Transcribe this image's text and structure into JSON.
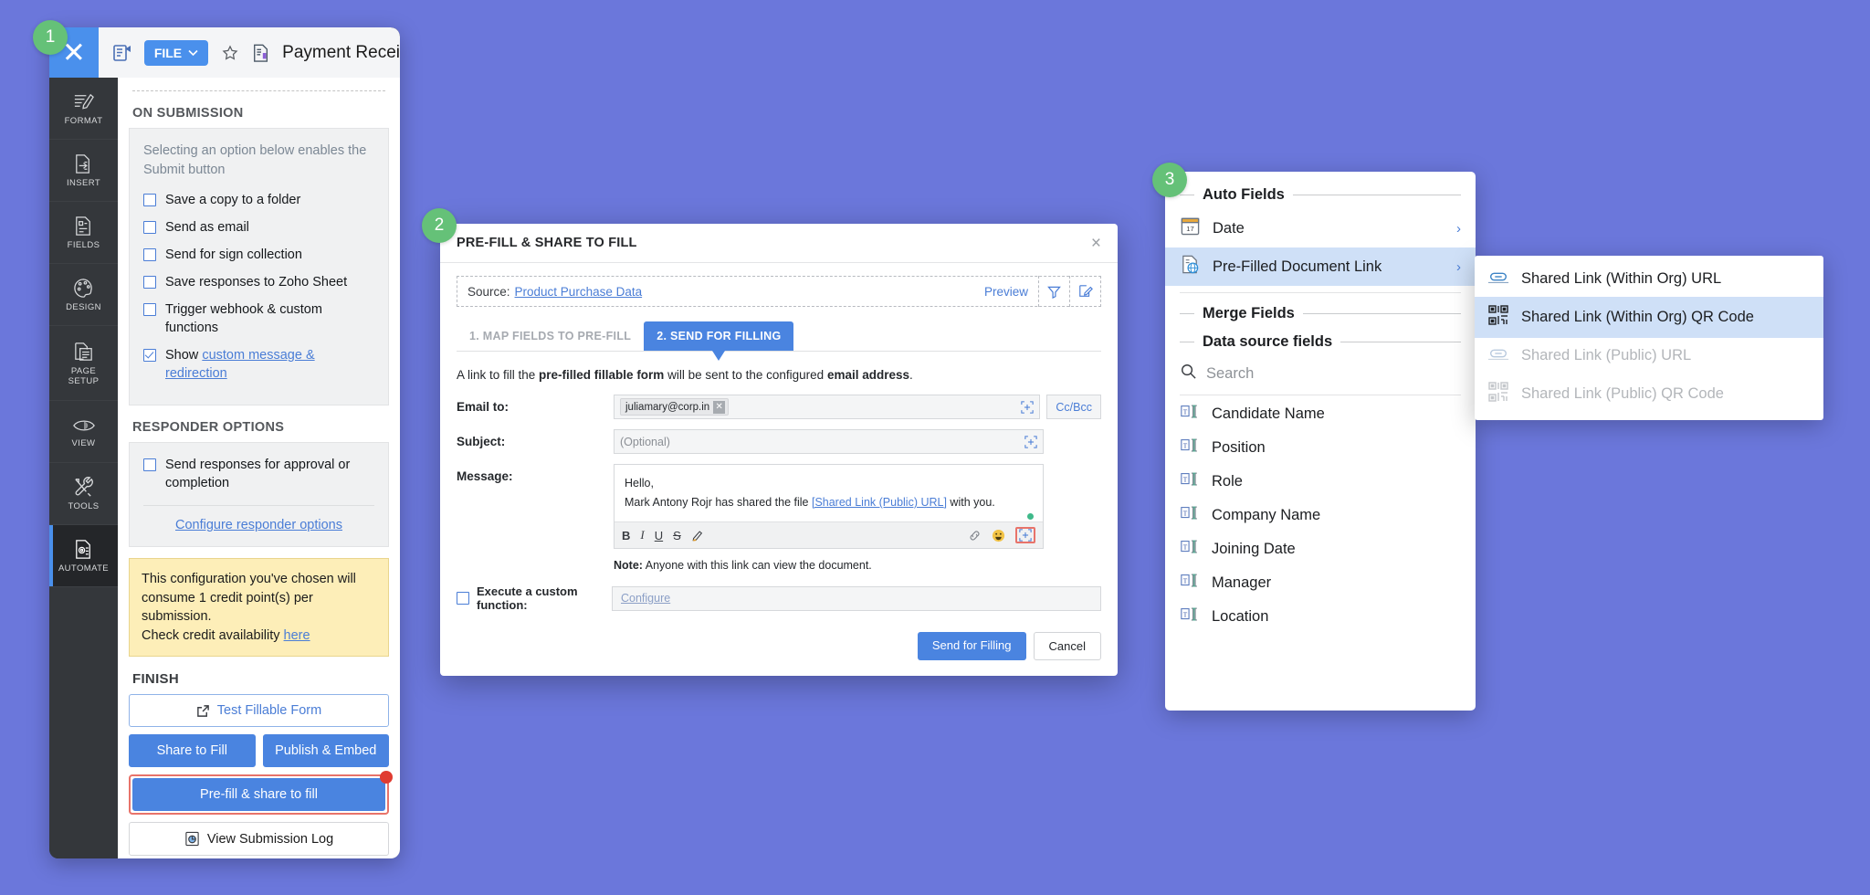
{
  "app": {
    "titlebar": {
      "close_label": "✕",
      "file_button": "FILE",
      "document_title": "Payment Recei"
    },
    "rail": [
      {
        "label": "FORMAT",
        "icon": "format-brush-icon"
      },
      {
        "label": "INSERT",
        "icon": "insert-page-icon"
      },
      {
        "label": "FIELDS",
        "icon": "fields-icon"
      },
      {
        "label": "DESIGN",
        "icon": "palette-icon"
      },
      {
        "label": "PAGE\nSETUP",
        "line1": "PAGE",
        "line2": "SETUP",
        "icon": "page-setup-icon"
      },
      {
        "label": "VIEW",
        "icon": "eye-icon"
      },
      {
        "label": "TOOLS",
        "icon": "tools-icon"
      },
      {
        "label": "AUTOMATE",
        "icon": "automate-gear-doc-icon"
      }
    ],
    "panel": {
      "on_submission_heading": "ON SUBMISSION",
      "hint": "Selecting an option below enables the Submit button",
      "checkboxes": [
        {
          "label": "Save a copy to a folder",
          "checked": false
        },
        {
          "label": "Send as email",
          "checked": false
        },
        {
          "label": "Send for sign collection",
          "checked": false
        },
        {
          "label": "Save responses to Zoho Sheet",
          "checked": false
        },
        {
          "label": "Trigger webhook & custom functions",
          "checked": false
        }
      ],
      "show_checkbox": {
        "prefix": "Show ",
        "link": "custom message & redirection",
        "checked": true
      },
      "responder_heading": "RESPONDER OPTIONS",
      "responder_checkbox": {
        "label": "Send responses for approval or completion",
        "checked": false
      },
      "configure_responder_link": "Configure responder options",
      "credit_note_line1": "This configuration you've chosen will consume 1 credit point(s) per submission.",
      "credit_note_line2_prefix": "Check credit availability ",
      "credit_note_link": "here",
      "finish_heading": "FINISH",
      "test_fillable_form": "Test Fillable Form",
      "share_to_fill": "Share to Fill",
      "publish_embed": "Publish & Embed",
      "prefill_share": "Pre-fill & share to fill",
      "view_submission_log": "View Submission Log"
    }
  },
  "modal": {
    "title": "PRE-FILL & SHARE TO FILL",
    "close": "×",
    "source_label": "Source:",
    "source_value": "Product Purchase Data",
    "preview_label": "Preview",
    "tabs": [
      {
        "label": "1. MAP FIELDS TO PRE-FILL",
        "active": false
      },
      {
        "label": "2. SEND FOR FILLING",
        "active": true
      }
    ],
    "lead_text_parts": {
      "a": "A link to fill the ",
      "b": "pre-filled fillable form",
      "c": " will be sent to the configured ",
      "d": "email address",
      "e": "."
    },
    "email_label": "Email to:",
    "email_chip": "juliamary@corp.in",
    "cc_bcc": "Cc/Bcc",
    "subject_label": "Subject:",
    "subject_placeholder": "(Optional)",
    "message_label": "Message:",
    "message_line1": "Hello,",
    "message_line2_a": "Mark Antony Rojr has shared the file ",
    "message_link": "[Shared Link (Public) URL]",
    "message_line2_b": " with you.",
    "toolbar": [
      "B",
      "I",
      "U",
      "S",
      "highlight-pen-icon",
      "link-icon",
      "emoji-icon",
      "insert-field-icon"
    ],
    "note_bold": "Note:",
    "note_text": " Anyone with this link can view the document.",
    "custom_function_label": "Execute a custom function:",
    "configure_link": "Configure",
    "send_button": "Send for Filling",
    "cancel_button": "Cancel"
  },
  "autofields": {
    "group_auto": "Auto Fields",
    "items": [
      {
        "label": "Date",
        "icon": "calendar-icon",
        "selected": false,
        "chevron": "›"
      },
      {
        "label": "Pre-Filled Document Link",
        "icon": "prefilled-doc-link-icon",
        "selected": true,
        "chevron": "›"
      }
    ],
    "group_merge": "Merge Fields",
    "group_datasource": "Data source fields",
    "search_placeholder": "Search",
    "fields": [
      "Candidate Name",
      "Position",
      "Role",
      "Company Name",
      "Joining Date",
      "Manager",
      "Location"
    ]
  },
  "submenu": {
    "items": [
      {
        "label": "Shared Link (Within Org) URL",
        "icon": "link-icon",
        "selected": false,
        "disabled": false
      },
      {
        "label": "Shared Link (Within Org) QR Code",
        "icon": "qr-icon",
        "selected": true,
        "disabled": false
      },
      {
        "label": "Shared Link (Public) URL",
        "icon": "link-icon",
        "selected": false,
        "disabled": true
      },
      {
        "label": "Shared Link (Public) QR Code",
        "icon": "qr-icon",
        "selected": false,
        "disabled": true
      }
    ]
  },
  "badges": {
    "one": "1",
    "two": "2",
    "three": "3"
  },
  "colors": {
    "background": "#6b77db",
    "accent_blue": "#4a84e0",
    "badge_green": "#65c178",
    "highlight_red": "#e8736a",
    "note_yellow": "#fdeeb8",
    "selection_blue": "#cfe0f7"
  }
}
